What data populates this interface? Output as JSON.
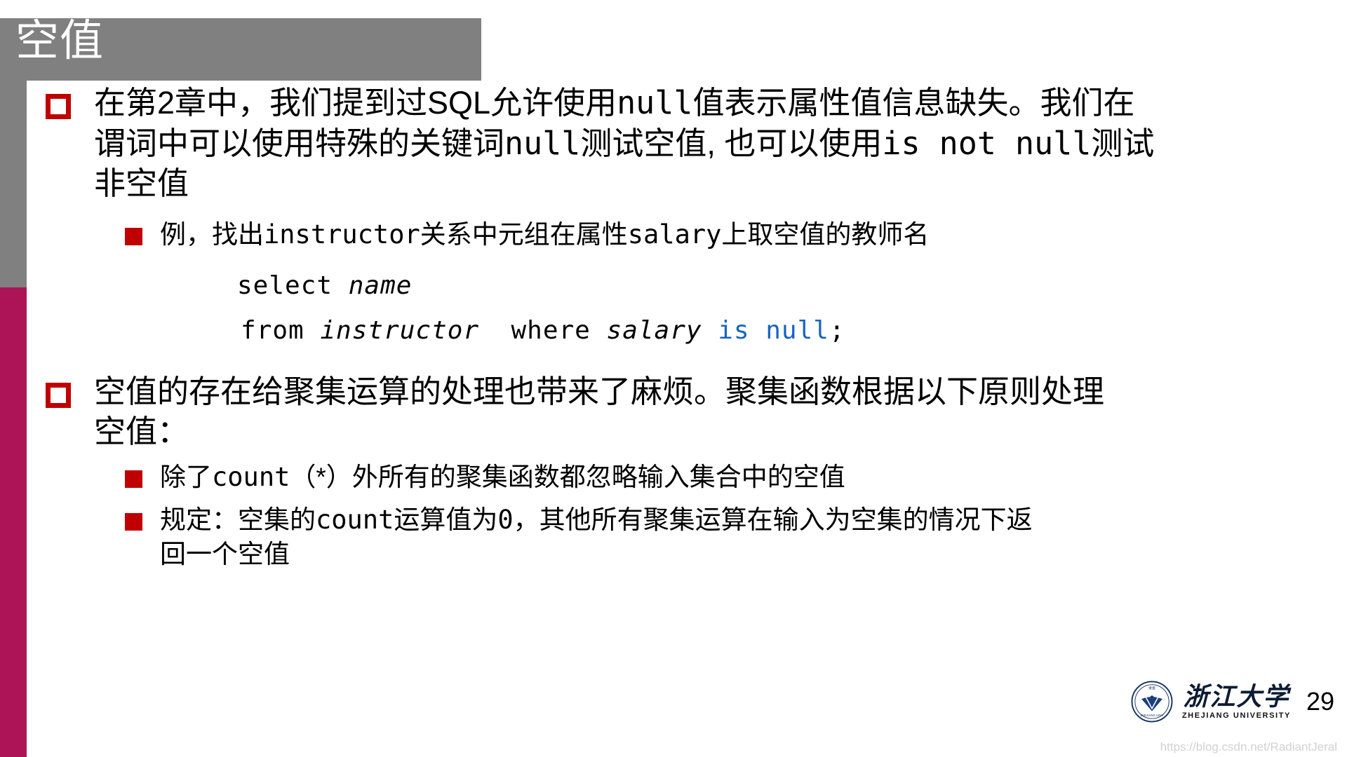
{
  "slide": {
    "title": "空值",
    "page_number": "29"
  },
  "colors": {
    "title_band": "#808080",
    "sidebar_gray": "#808080",
    "sidebar_crimson": "#ad1457",
    "bullet_red": "#c00000",
    "keyword_blue": "#1565c0",
    "logo_navy": "#0d1c33"
  },
  "bullets": {
    "b1": {
      "line1": "在第2章中，我们提到过SQL允许使用",
      "line1_mono": "null",
      "line1_tail": "值表示属性值信息缺失。我们在",
      "line2": "谓词中可以使用特殊的关键词",
      "line2_mono": "null",
      "line2_mid": "测试空值, 也可以使用",
      "line2_mono2": "is not null",
      "line2_tail": "测试",
      "line3": "非空值"
    },
    "b1_sub1": {
      "pre": "例，找出",
      "mono1": "instructor",
      "mid": "关系中元组在属性",
      "mono2": "salary",
      "tail": "上取空值的教师名"
    },
    "code": {
      "line1_kw": "select ",
      "line1_id": "name",
      "line2_kw": "from ",
      "line2_id": "instructor",
      "line2_kw2": "  where ",
      "line2_id2": "salary",
      "line2_blue": " is null",
      "line2_end": ";"
    },
    "b2": {
      "line1": "空值的存在给聚集运算的处理也带来了麻烦。聚集函数根据以下原则处理",
      "line2": "空值："
    },
    "b2_sub1": {
      "pre": "除了",
      "mono": "count",
      "tail": "（*）外所有的聚集函数都忽略输入集合中的空值"
    },
    "b2_sub2": {
      "pre": "规定：空集的",
      "mono": "count",
      "mid": "运算值为",
      "zero": "0",
      "tail": "，其他所有聚集运算在输入为空集的情况下返",
      "line2": "回一个空值"
    }
  },
  "footer": {
    "logo_cn": "浙江大学",
    "logo_en": "ZHEJIANG UNIVERSITY",
    "watermark": "https://blog.csdn.net/RadiantJeral"
  }
}
